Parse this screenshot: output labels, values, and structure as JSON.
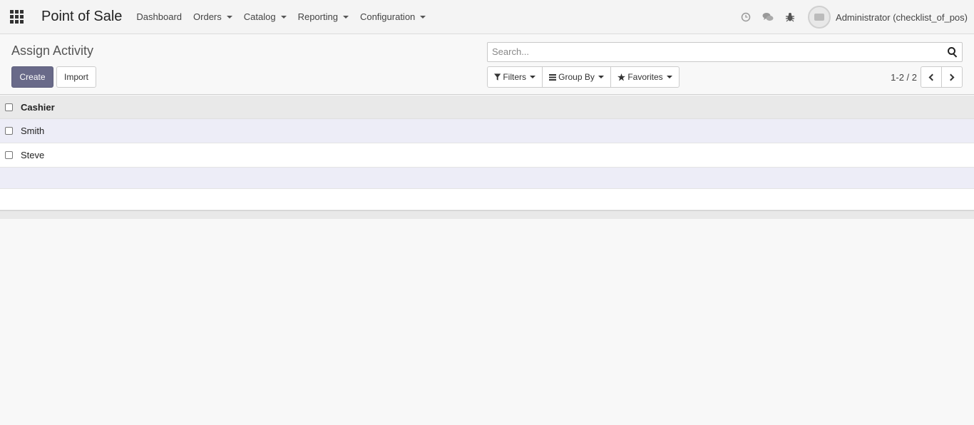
{
  "navbar": {
    "app_name": "Point of Sale",
    "menu": [
      {
        "label": "Dashboard",
        "dropdown": false
      },
      {
        "label": "Orders",
        "dropdown": true
      },
      {
        "label": "Catalog",
        "dropdown": true
      },
      {
        "label": "Reporting",
        "dropdown": true
      },
      {
        "label": "Configuration",
        "dropdown": true
      }
    ],
    "systray": [
      "clock-icon",
      "chat-icon",
      "bug-icon"
    ],
    "user_name": "Administrator (checklist_of_pos)"
  },
  "control_panel": {
    "breadcrumb": "Assign Activity",
    "create_label": "Create",
    "import_label": "Import",
    "search_placeholder": "Search...",
    "filters_label": "Filters",
    "group_by_label": "Group By",
    "favorites_label": "Favorites",
    "pager_value": "1-2 / 2"
  },
  "list": {
    "columns": [
      "Cashier"
    ],
    "rows": [
      {
        "cashier": "Smith"
      },
      {
        "cashier": "Steve"
      }
    ]
  },
  "colors": {
    "primary": "#696a89",
    "row_highlight": "#ededf7"
  }
}
